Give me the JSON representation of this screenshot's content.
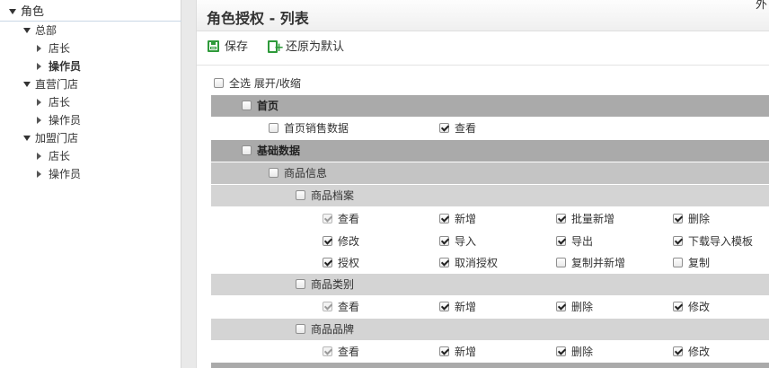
{
  "tree": {
    "root": "角色",
    "groups": [
      {
        "label": "总部",
        "children": [
          {
            "label": "店长",
            "bold": false
          },
          {
            "label": "操作员",
            "bold": true
          }
        ]
      },
      {
        "label": "直营门店",
        "children": [
          {
            "label": "店长",
            "bold": false
          },
          {
            "label": "操作员",
            "bold": false
          }
        ]
      },
      {
        "label": "加盟门店",
        "children": [
          {
            "label": "店长",
            "bold": false
          },
          {
            "label": "操作员",
            "bold": false
          }
        ]
      }
    ]
  },
  "main": {
    "title": "角色授权 - 列表",
    "corner_fragment": "外",
    "toolbar": {
      "save_label": "保存",
      "restore_label": "还原为默认"
    },
    "select_all_label": "全选 展开/收缩",
    "sections": {
      "home": "首页",
      "home_sales": "首页销售数据",
      "home_view": "查看",
      "basic": "基础数据",
      "goods_info": "商品信息",
      "goods_archive": "商品档案",
      "goods_category": "商品类别",
      "goods_brand": "商品品牌"
    },
    "archive_perms": [
      [
        "查看",
        "新增",
        "批量新增",
        "删除"
      ],
      [
        "修改",
        "导入",
        "导出",
        "下载导入模板"
      ],
      [
        "授权",
        "取消授权",
        "复制并新增",
        "复制"
      ]
    ],
    "category_perms": [
      "查看",
      "新增",
      "删除",
      "修改"
    ],
    "brand_perms": [
      "查看",
      "新增",
      "删除",
      "修改"
    ]
  },
  "colors": {
    "accent": "#2e9a3a",
    "bar_level1": "#aaaaaa",
    "bar_level2": "#c4c4c4",
    "bar_level3": "#d4d4d4"
  }
}
